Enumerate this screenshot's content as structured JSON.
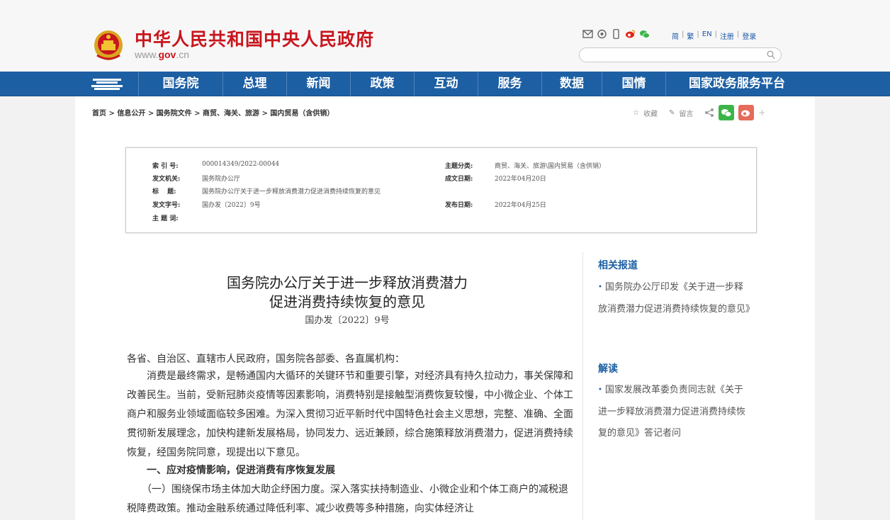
{
  "header": {
    "site_title": "中华人民共和国中央人民政府",
    "site_url_prefix": "www.",
    "site_url_domain": "gov",
    "site_url_suffix": ".cn",
    "icons": [
      "mail-icon",
      "globe-icon",
      "mobile-icon",
      "weibo-icon",
      "wechat-icon"
    ],
    "links": [
      "简",
      "繁",
      "EN",
      "注册",
      "登录"
    ],
    "search_placeholder": ""
  },
  "nav": {
    "items": [
      "国务院",
      "总理",
      "新闻",
      "政策",
      "互动",
      "服务",
      "数据",
      "国情",
      "国家政务服务平台"
    ]
  },
  "breadcrumb": "首页 > 信息公开 > 国务院文件 > 商贸、海关、旅游 > 国内贸易（含供销）",
  "tools": {
    "favorite": "收藏",
    "comment": "留言"
  },
  "meta": {
    "index_no_label": "索 引 号:",
    "index_no": "000014349/2022-00044",
    "issuer_label": "发文机关:",
    "issuer": "国务院办公厅",
    "title_label": "标　 题:",
    "title": "国务院办公厅关于进一步释放消费潜力促进消费持续恢复的意见",
    "docno_label": "发文字号:",
    "docno": "国办发〔2022〕9号",
    "keywords_label": "主 题 词:",
    "category_label": "主题分类:",
    "category": "商贸、海关、旅游\\国内贸易（含供销）",
    "written_label": "成文日期:",
    "written": "2022年04月20日",
    "published_label": "发布日期:",
    "published": "2022年04月25日"
  },
  "article": {
    "title_line1": "国务院办公厅关于进一步释放消费潜力",
    "title_line2": "促进消费持续恢复的意见",
    "docno": "国办发〔2022〕9号",
    "salutation": "各省、自治区、直辖市人民政府，国务院各部委、各直属机构：",
    "para1": "　　消费是最终需求，是畅通国内大循环的关键环节和重要引擎，对经济具有持久拉动力，事关保障和改善民生。当前，受新冠肺炎疫情等因素影响，消费特别是接触型消费恢复较慢，中小微企业、个体工商户和服务业领域面临较多困难。为深入贯彻习近平新时代中国特色社会主义思想，完整、准确、全面贯彻新发展理念，加快构建新发展格局，协同发力、远近兼顾，综合施策释放消费潜力，促进消费持续恢复，经国务院同意，现提出以下意见。",
    "heading1": "　　一、应对疫情影响，促进消费有序恢复发展",
    "para2": "　　（一）围绕保市场主体加大助企纾困力度。深入落实扶持制造业、小微企业和个体工商户的减税退税降费政策。推动金融系统通过降低利率、减少收费等多种措施，向实体经济让"
  },
  "sidebar": {
    "related_head": "相关报道",
    "related_item": "国务院办公厅印发《关于进一步释放消费潜力促进消费持续恢复的意见》",
    "interpret_head": "解读",
    "interpret_item": "国家发展改革委负责同志就《关于进一步释放消费潜力促进消费持续恢复的意见》答记者问"
  },
  "colors": {
    "brand_red": "#c8161d",
    "nav_blue": "#1d5fa3"
  }
}
